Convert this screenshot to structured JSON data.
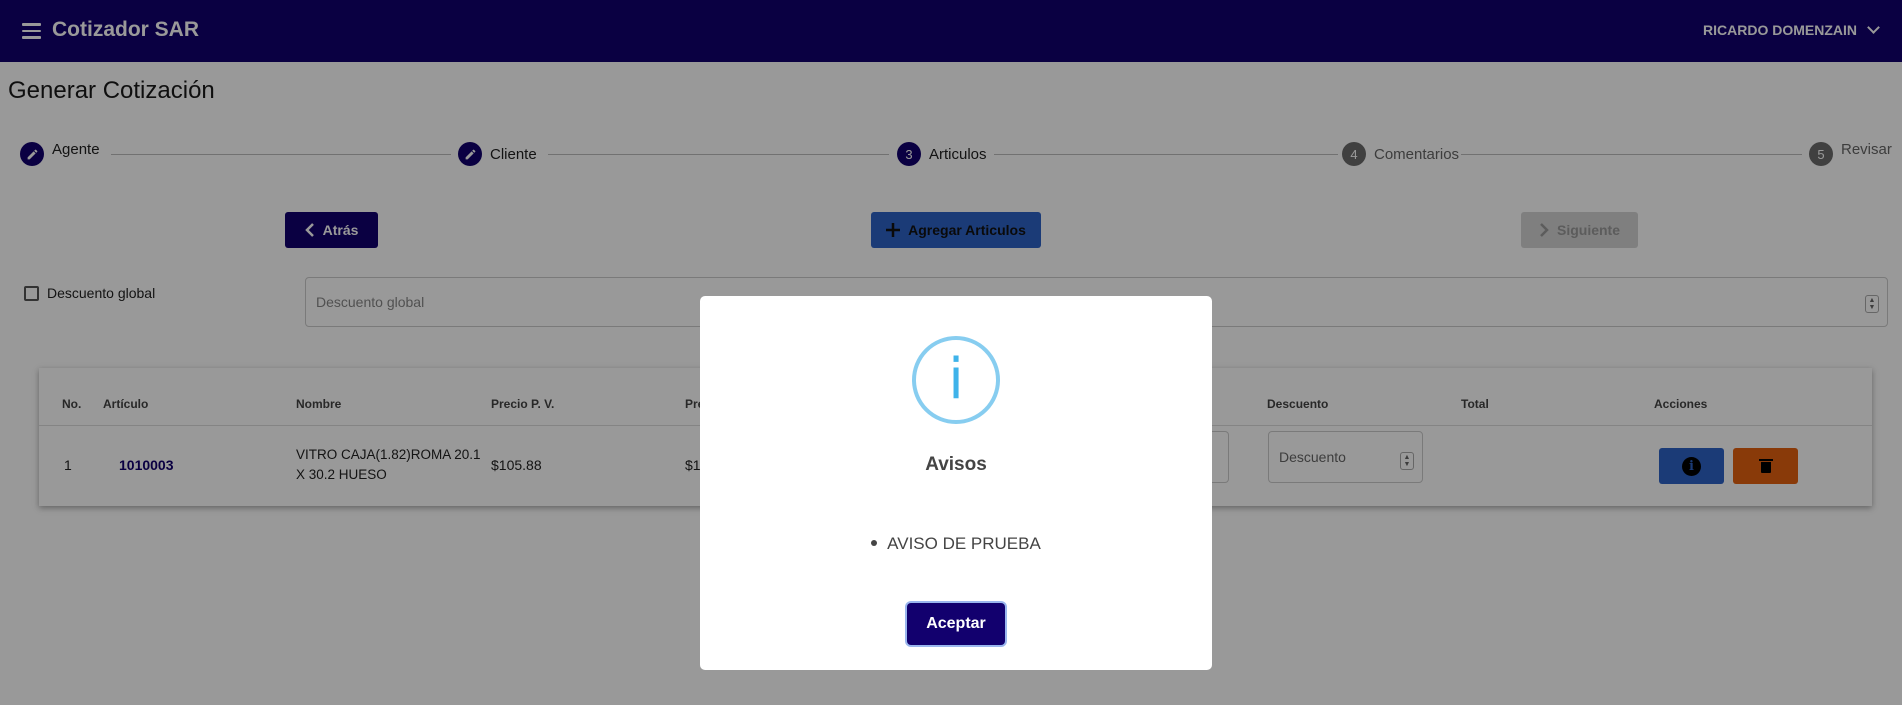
{
  "app": {
    "title": "Cotizador SAR",
    "user": "RICARDO DOMENZAIN"
  },
  "page": {
    "title": "Generar Cotización"
  },
  "stepper": [
    {
      "label": "Agente",
      "state": "done",
      "icon": "pencil-icon"
    },
    {
      "label": "Cliente",
      "state": "done",
      "icon": "pencil-icon"
    },
    {
      "label": "Articulos",
      "state": "active",
      "number": "3"
    },
    {
      "label": "Comentarios",
      "state": "idle",
      "number": "4"
    },
    {
      "label": "Revisar",
      "state": "idle",
      "number": "5"
    }
  ],
  "actions": {
    "back": "Atrás",
    "add": "Agregar Articulos",
    "next": "Siguiente"
  },
  "global_discount": {
    "checkbox_label": "Descuento global",
    "placeholder": "Descuento global"
  },
  "table": {
    "headers": {
      "no": "No.",
      "articulo": "Artículo",
      "nombre": "Nombre",
      "precio_pv": "Precio P. V.",
      "precio_partial": "Pre",
      "descuento": "Descuento",
      "total": "Total",
      "acciones": "Acciones"
    },
    "rows": [
      {
        "no": "1",
        "articulo": "1010003",
        "nombre_line1": "VITRO CAJA(1.82)ROMA 20.1",
        "nombre_line2": "X 30.2 HUESO",
        "precio_pv": "$105.88",
        "precio_partial": "$1",
        "descuento_placeholder": "Descuento",
        "total": ""
      }
    ]
  },
  "modal": {
    "title": "Avisos",
    "items": [
      "AVISO DE PRUEBA"
    ],
    "accept": "Aceptar"
  },
  "colors": {
    "primary": "#12006e",
    "blue_button": "#2e63c6",
    "delete_button": "#e5620f",
    "info_ring": "#87cdf0"
  }
}
